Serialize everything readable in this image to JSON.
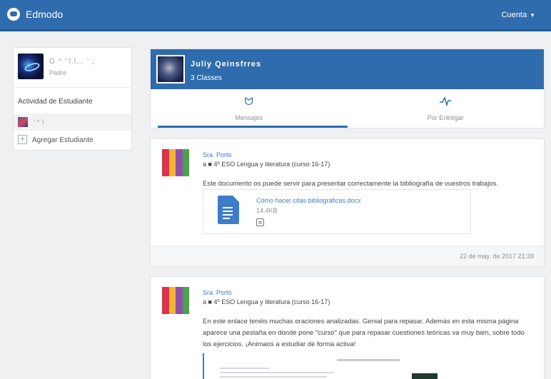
{
  "app": {
    "name": "Edmodo",
    "account_label": "Cuenta",
    "accent": "#2f6cae"
  },
  "sidebar": {
    "profile_name": "G ^ ''l.l,.. ' ;",
    "profile_role": "Padre",
    "activity_title": "Actividad de Estudiante",
    "student_name": "' ^ 'i",
    "add_student": "Agregar Estudiante"
  },
  "class_header": {
    "name": "Juliy Qeinsfrres",
    "count": "3 Classes",
    "tabs": [
      {
        "label": "Mensajes",
        "icon": "megaphone-icon",
        "active": true
      },
      {
        "label": "Por Entregar",
        "icon": "pulse-icon",
        "active": false
      }
    ]
  },
  "posts": [
    {
      "author": "Sra. Porto",
      "target": "a ■ 4º ESO Lengua y literatura (curso 16-17)",
      "text": "Este documento os puede servir para presentar correctamente la bibliografía de vuestros trabajos.",
      "attachment": {
        "name": "Cómo hacer citas bibliográficas.docx",
        "size": "14.4KB"
      },
      "timestamp": "22 de may. de 2017 21:39"
    },
    {
      "author": "Sra. Porto",
      "target": "a ■ 4º ESO Lengua y literatura (curso 16-17)",
      "text": "En este enlace tenéis muchas oraciones analizadas. Genial para repasar. Además en esta misma página aparece una pestaña en donde pone \"curso\" que para repasar cuestiones teóricas va muy bien, sobre todo los ejercicios. ¡Animaos a estudiar de forma activa!"
    }
  ]
}
